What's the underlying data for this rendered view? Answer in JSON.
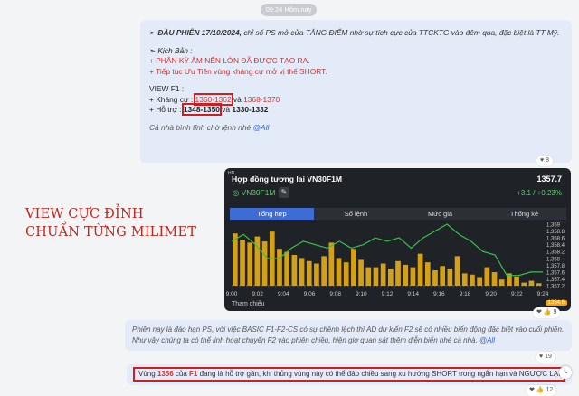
{
  "timestamp": "09:24 Hôm nay",
  "message1": {
    "headline_prefix": "➣ ",
    "headline_bold": "ĐẦU PHIÊN 17/10/2024,",
    "headline_rest": " chỉ số PS mở cửa TĂNG ĐIỂM nhờ sự tích cực của TTCKTG vào đêm qua, đặc biệt là TT Mỹ.",
    "scenario_title": "➣ Kịch Bản :",
    "scenario_1": "+ PHÂN KỲ ÂM NẾN LỚN ĐÃ ĐƯỢC TẠO RA.",
    "scenario_2": "+ Tiếp tục Ưu Tiên vùng kháng cự mở vị thế SHORT.",
    "view_title": "VIEW F1 :",
    "resist_label": "+ Kháng cự : ",
    "resist_1": "1360-1362",
    "resist_mid": " và ",
    "resist_2": "1368-1370",
    "support_label": "+ Hỗ trợ : ",
    "support_1": "1348-1350",
    "support_mid": " và ",
    "support_2": "1330-1332",
    "closing": "Cả nhà bình tĩnh chờ lệnh nhé ",
    "mention": "@All",
    "reaction": "♥ 8"
  },
  "chart_card": {
    "hd": "HD",
    "title": "Hợp đồng tương lai VN30F1M",
    "price": "1357.7",
    "ticker": "VN30F1M",
    "change": "+3.1 / +0.23%",
    "tabs": [
      "Tổng hợp",
      "Số lệnh",
      "Mức giá",
      "Thống kê"
    ],
    "footer": "Tham chiếu",
    "footer_badge": "1354.6",
    "reaction": "❤ 👍 9"
  },
  "annotation": {
    "line1": "VIEW CỰC ĐỈNH",
    "line2": "CHUẨN TỪNG MILIMET"
  },
  "message2": {
    "line1": "Phiên nay là đáo hạn PS, với việc BASIC F1-F2-CS có sự chênh lệch thì AD dự kiến F2 sẽ có nhiều biến động đặc biệt vào cuối phiên.",
    "line2": "Như vậy chúng ta có thể linh hoạt chuyển F2 vào phiên chiều, hiện giờ quan sát thêm diễn biến nhé cả nhà. ",
    "mention": "@All",
    "reaction": "♥ 19"
  },
  "message3": {
    "t1": "Vùng ",
    "v1": "1356",
    "t2": " của ",
    "v2": "F1",
    "t3": " đang là hỗ trợ gần, khi thủng vùng này có thể đảo chiều sang xu hướng SHORT trong ngắn hạn và NGƯỢC LẠI",
    "reaction": "❤ 👍 12"
  },
  "chart_data": {
    "type": "line",
    "x": [
      "9:00",
      "9:02",
      "9:04",
      "9:06",
      "9:08",
      "9:10",
      "9:12",
      "9:14",
      "9:16",
      "9:18",
      "9:20",
      "9:22",
      "9:24"
    ],
    "y_ticks": [
      1357.2,
      1357.4,
      1357.6,
      1357.8,
      1358,
      1358.2,
      1358.4,
      1358.6,
      1358.8,
      1359
    ],
    "y_tick_labels": [
      "1,357.2",
      "1,357.4",
      "1,357.6",
      "1,357.8",
      "1,358",
      "1,358.2",
      "1,358.4",
      "1,358.6",
      "1,358.8",
      "1,359"
    ],
    "ylim": [
      1357.2,
      1359
    ],
    "price_line": [
      1358.5,
      1358.7,
      1358.4,
      1358.0,
      1358.0,
      1358.3,
      1358.5,
      1358.4,
      1358.3,
      1358.5,
      1358.3,
      1358.4,
      1358.6,
      1358.5,
      1358.6,
      1358.3,
      1358.6,
      1358.8,
      1359.0,
      1358.7,
      1358.5,
      1358.2,
      1358.1,
      1357.5,
      1357.5,
      1357.6,
      1357.6
    ],
    "price_line_color": "#35c24b",
    "volume_bars": [
      85,
      75,
      70,
      80,
      72,
      88,
      60,
      55,
      50,
      45,
      40,
      36,
      48,
      70,
      45,
      38,
      60,
      42,
      30,
      30,
      36,
      28,
      40,
      34,
      30,
      52,
      38,
      25,
      32,
      28,
      48,
      20,
      18,
      14,
      30,
      22,
      10,
      20,
      15,
      5,
      8,
      4
    ],
    "volume_color": "#d4a017",
    "reference": 1357.2,
    "reference_color": "#f4a01a"
  }
}
